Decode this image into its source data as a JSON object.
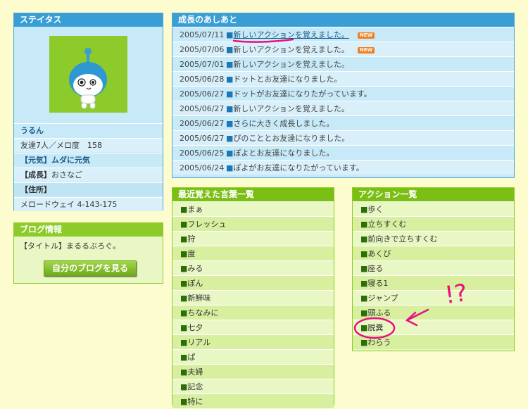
{
  "status": {
    "title": "ステイタス",
    "name": "うるん",
    "friends": "友達7人／メロ度　158",
    "genki": "【元気】ムダに元気",
    "seichou_label": "【成長】",
    "seichou_value": "おさなご",
    "address_label": "【住所】",
    "address_value": "メロードウェイ 4-143-175"
  },
  "blog": {
    "title": "ブログ情報",
    "blog_title": "【タイトル】まるるぶろぐ。",
    "button": "自分のブログを見る"
  },
  "history": {
    "title": "成長のあしあと",
    "items": [
      {
        "date": "2005/07/11",
        "text": "新しいアクションを覚えました。",
        "new": "NEW"
      },
      {
        "date": "2005/07/06",
        "text": "新しいアクションを覚えました。",
        "new": "NEW"
      },
      {
        "date": "2005/07/01",
        "text": "新しいアクションを覚えました。",
        "new": ""
      },
      {
        "date": "2005/06/28",
        "text": "ドットとお友達になりました。",
        "new": ""
      },
      {
        "date": "2005/06/27",
        "text": "ドットがお友達になりたがっています。",
        "new": ""
      },
      {
        "date": "2005/06/27",
        "text": "新しいアクションを覚えました。",
        "new": ""
      },
      {
        "date": "2005/06/27",
        "text": "さらに大きく成長しました。",
        "new": ""
      },
      {
        "date": "2005/06/27",
        "text": "ぴのこととお友達になりました。",
        "new": ""
      },
      {
        "date": "2005/06/25",
        "text": "ぽよとお友達になりました。",
        "new": ""
      },
      {
        "date": "2005/06/24",
        "text": "ぽよがお友達になりたがっています。",
        "new": ""
      }
    ]
  },
  "words": {
    "title": "最近覚えた言葉一覧",
    "items": [
      "まぁ",
      "フレッシュ",
      "狩",
      "度",
      "みる",
      "ぽん",
      "新鮮味",
      "ちなみに",
      "七夕",
      "リアル",
      "ぱ",
      "夫婦",
      "記念",
      "特に"
    ]
  },
  "actions": {
    "title": "アクション一覧",
    "items": [
      "歩く",
      "立ちすくむ",
      "前向きで立ちすくむ",
      "あくび",
      "座る",
      "寝る1",
      "ジャンプ",
      "頭ふる",
      "脱糞",
      "わらう"
    ]
  },
  "annotation": {
    "text": "!?"
  },
  "bullet": "■"
}
